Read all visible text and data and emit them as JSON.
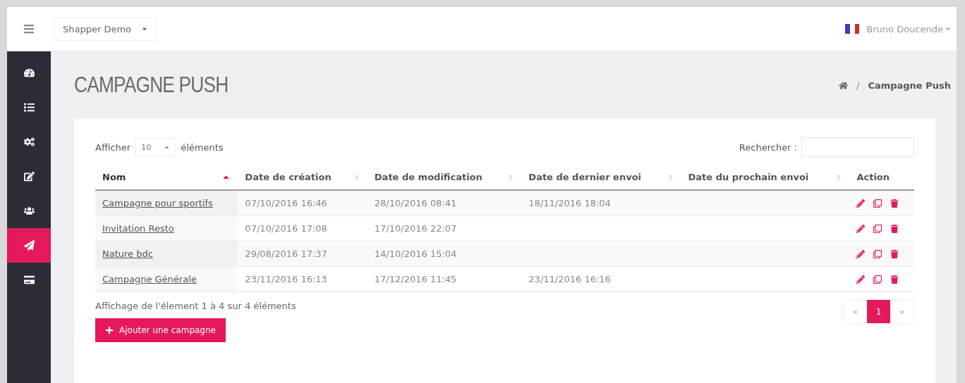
{
  "header": {
    "project_select": "Shapper Demo",
    "user": "Bruno Doucende"
  },
  "sidebar": {
    "items": [
      {
        "selected": false
      },
      {
        "selected": false
      },
      {
        "selected": false
      },
      {
        "selected": false
      },
      {
        "selected": false
      },
      {
        "selected": true
      },
      {
        "selected": false
      }
    ]
  },
  "page": {
    "title": "CAMPAGNE PUSH",
    "breadcrumb_separator": "/",
    "breadcrumb": "Campagne Push"
  },
  "table_controls": {
    "show_label": "Afficher",
    "page_size": "10",
    "items_label": "éléments",
    "search_label": "Rechercher :"
  },
  "table": {
    "columns": [
      {
        "label": "Nom",
        "sortable": true,
        "sorted": true
      },
      {
        "label": "Date de création",
        "sortable": true,
        "sorted": false
      },
      {
        "label": "Date de modification",
        "sortable": true,
        "sorted": false
      },
      {
        "label": "Date de dernier envoi",
        "sortable": true,
        "sorted": false
      },
      {
        "label": "Date du prochain envoi",
        "sortable": true,
        "sorted": false
      },
      {
        "label": "Action",
        "sortable": false,
        "sorted": false
      }
    ],
    "rows": [
      {
        "name": "Campagne pour sportifs",
        "created": "07/10/2016 16:46",
        "modified": "28/10/2016 08:41",
        "last_sent": "18/11/2016 18:04"
      },
      {
        "name": "Invitation Resto",
        "created": "07/10/2016 17:08",
        "modified": "17/10/2016 22:07"
      },
      {
        "name": "Nature bdc",
        "created": "29/08/2016 17:37",
        "modified": "14/10/2016 15:04"
      },
      {
        "name": "Campagne Générale",
        "created": "23/11/2016 16:13",
        "modified": "17/12/2016 11:45",
        "last_sent": "23/11/2016 16:16"
      }
    ]
  },
  "footer": {
    "info": "Affichage de l'élement 1 à 4 sur 4 éléments",
    "add_button": "Ajouter une campagne",
    "pagination": [
      {
        "label": "«",
        "selected": false
      },
      {
        "label": "1",
        "selected": true
      },
      {
        "label": "»",
        "selected": false
      }
    ]
  }
}
